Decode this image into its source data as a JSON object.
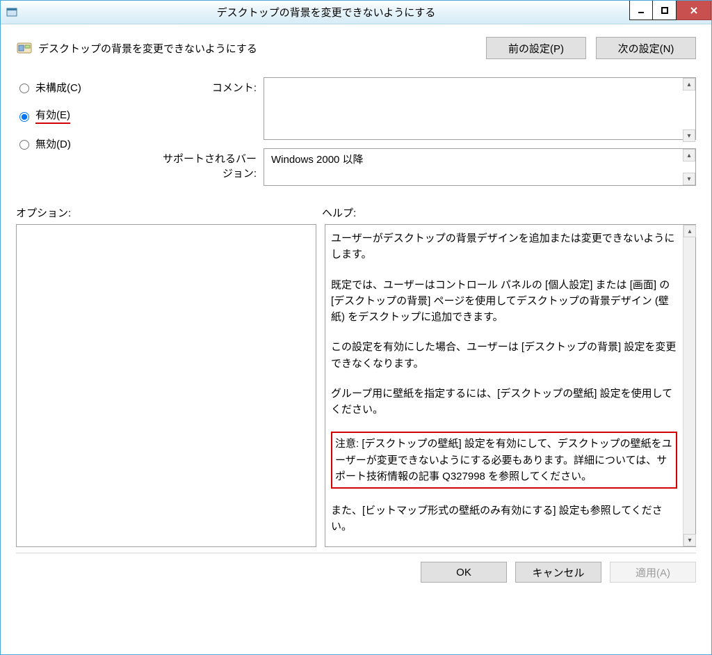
{
  "window": {
    "title": "デスクトップの背景を変更できないようにする"
  },
  "header": {
    "policy_title": "デスクトップの背景を変更できないようにする",
    "prev_label": "前の設定(P)",
    "next_label": "次の設定(N)"
  },
  "radios": {
    "not_configured": "未構成(C)",
    "enabled": "有効(E)",
    "disabled": "無効(D)",
    "selected": "enabled"
  },
  "labels": {
    "comment": "コメント:",
    "supported": "サポートされるバージョン:",
    "options": "オプション:",
    "help": "ヘルプ:"
  },
  "supported_text": "Windows 2000 以降",
  "help": {
    "p1": "ユーザーがデスクトップの背景デザインを追加または変更できないようにします。",
    "p2": "既定では、ユーザーはコントロール パネルの [個人設定] または [画面] の [デスクトップの背景] ページを使用してデスクトップの背景デザイン (壁紙) をデスクトップに追加できます。",
    "p3": "この設定を有効にした場合、ユーザーは [デスクトップの背景] 設定を変更できなくなります。",
    "p4": "グループ用に壁紙を指定するには、[デスクトップの壁紙] 設定を使用してください。",
    "p5": "注意: [デスクトップの壁紙] 設定を有効にして、デスクトップの壁紙をユーザーが変更できないようにする必要もあります。詳細については、サポート技術情報の記事 Q327998 を参照してください。",
    "p6": "また、[ビットマップ形式の壁紙のみ有効にする] 設定も参照してください。"
  },
  "footer": {
    "ok": "OK",
    "cancel": "キャンセル",
    "apply": "適用(A)"
  }
}
